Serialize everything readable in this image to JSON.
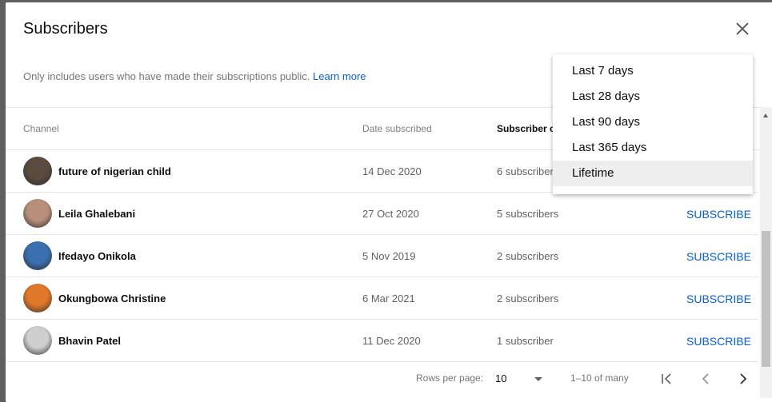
{
  "dialog": {
    "title": "Subscribers",
    "subtitle": "Only includes users who have made their subscriptions public.",
    "learn_more": "Learn more"
  },
  "table": {
    "headers": {
      "channel": "Channel",
      "date": "Date subscribed",
      "count": "Subscriber c"
    },
    "rows": [
      {
        "name": "future of nigerian child",
        "date": "14 Dec 2020",
        "count": "6 subscriber",
        "action": "",
        "avatar_color": "#5b4a3e"
      },
      {
        "name": "Leila Ghalebani",
        "date": "27 Oct 2020",
        "count": "5 subscribers",
        "action": "SUBSCRIBE",
        "avatar_color": "#b88f7a"
      },
      {
        "name": "Ifedayo Onikola",
        "date": "5 Nov 2019",
        "count": "2 subscribers",
        "action": "SUBSCRIBE",
        "avatar_color": "#3a6fb0"
      },
      {
        "name": "Okungbowa Christine",
        "date": "6 Mar 2021",
        "count": "2 subscribers",
        "action": "SUBSCRIBE",
        "avatar_color": "#e0782a"
      },
      {
        "name": "Bhavin Patel",
        "date": "11 Dec 2020",
        "count": "1 subscriber",
        "action": "SUBSCRIBE",
        "avatar_color": "#cfcfcf"
      }
    ]
  },
  "footer": {
    "rows_label": "Rows per page:",
    "rows_value": "10",
    "range": "1–10 of many"
  },
  "menu": {
    "items": [
      "Last 7 days",
      "Last 28 days",
      "Last 90 days",
      "Last 365 days",
      "Lifetime"
    ],
    "selected": "Lifetime"
  }
}
